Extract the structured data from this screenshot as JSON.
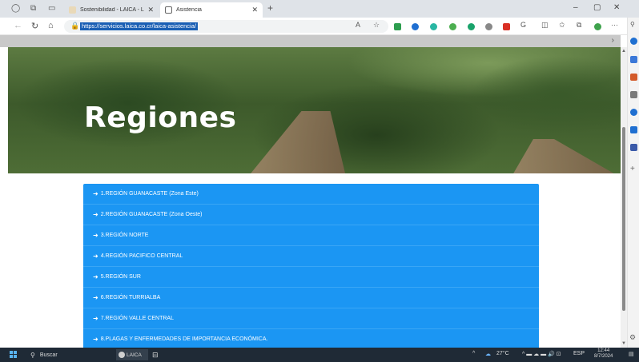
{
  "browser": {
    "tabs": [
      {
        "label": "Sostenibilidad - LAICA - La Liga",
        "active": false
      },
      {
        "label": "Asistencia",
        "active": true
      }
    ],
    "new_tab_symbol": "+",
    "url": "https://servicios.laica.co.cr/laica-asistencia/",
    "window_controls": [
      "–",
      "▢",
      "✕"
    ]
  },
  "page": {
    "hero_title": "Regiones",
    "regions": [
      "1.REGIÓN GUANACASTE (Zona Este)",
      "2.REGIÓN GUANACASTE (Zona Oeste)",
      "3.REGIÓN NORTE",
      "4.REGIÓN PACIFICO CENTRAL",
      "5.REGIÓN SUR",
      "6.REGIÓN TURRIALBA",
      "7.REGIÓN VALLE CENTRAL",
      "8.PLAGAS Y ENFERMEDADES DE IMPORTANCIA ECONÓMICA."
    ],
    "region_color": "#1b96f3"
  },
  "taskbar": {
    "search_placeholder": "Buscar",
    "app_label": "LAICA",
    "temperature": "27°C",
    "language": "ESP",
    "time": "12:44",
    "date": "8/7/2024"
  }
}
